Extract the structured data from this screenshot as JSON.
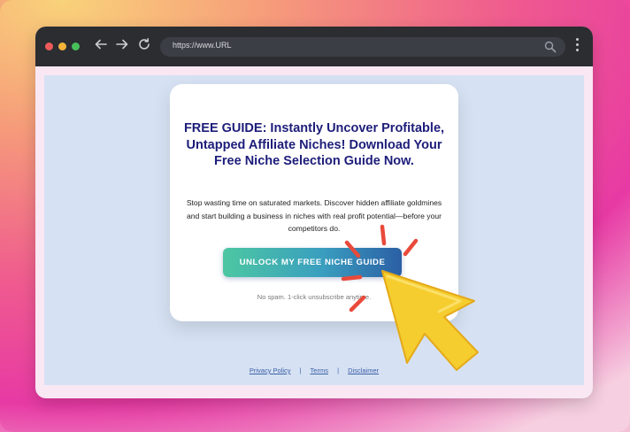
{
  "browser": {
    "url": "https://www.URL"
  },
  "card": {
    "headline": "FREE GUIDE: Instantly Uncover Profitable, Untapped Affiliate Niches! Download Your Free Niche Selection Guide Now.",
    "subtext": "Stop wasting time on saturated markets. Discover hidden affiliate goldmines and start building a business in niches with real profit potential—before your competitors do.",
    "cta_label": "UNLOCK MY FREE NICHE GUIDE",
    "fineprint": "No spam. 1-click unsubscribe anytime."
  },
  "footer": {
    "links": [
      "Privacy Policy",
      "Terms",
      "Disclaimer"
    ],
    "separator": "|"
  },
  "icons": {
    "back": "arrow-left-icon",
    "forward": "arrow-right-icon",
    "reload": "reload-icon",
    "search": "search-icon",
    "menu": "kebab-menu-icon",
    "cursor": "cursor-click-icon"
  },
  "colors": {
    "headline": "#1d1d7a",
    "cta_start": "#4cc7a2",
    "cta_end": "#2b5fa5",
    "page_bg": "#d6e2f3",
    "cursor_fill": "#f5cd2e",
    "click_burst": "#e94a3b"
  }
}
